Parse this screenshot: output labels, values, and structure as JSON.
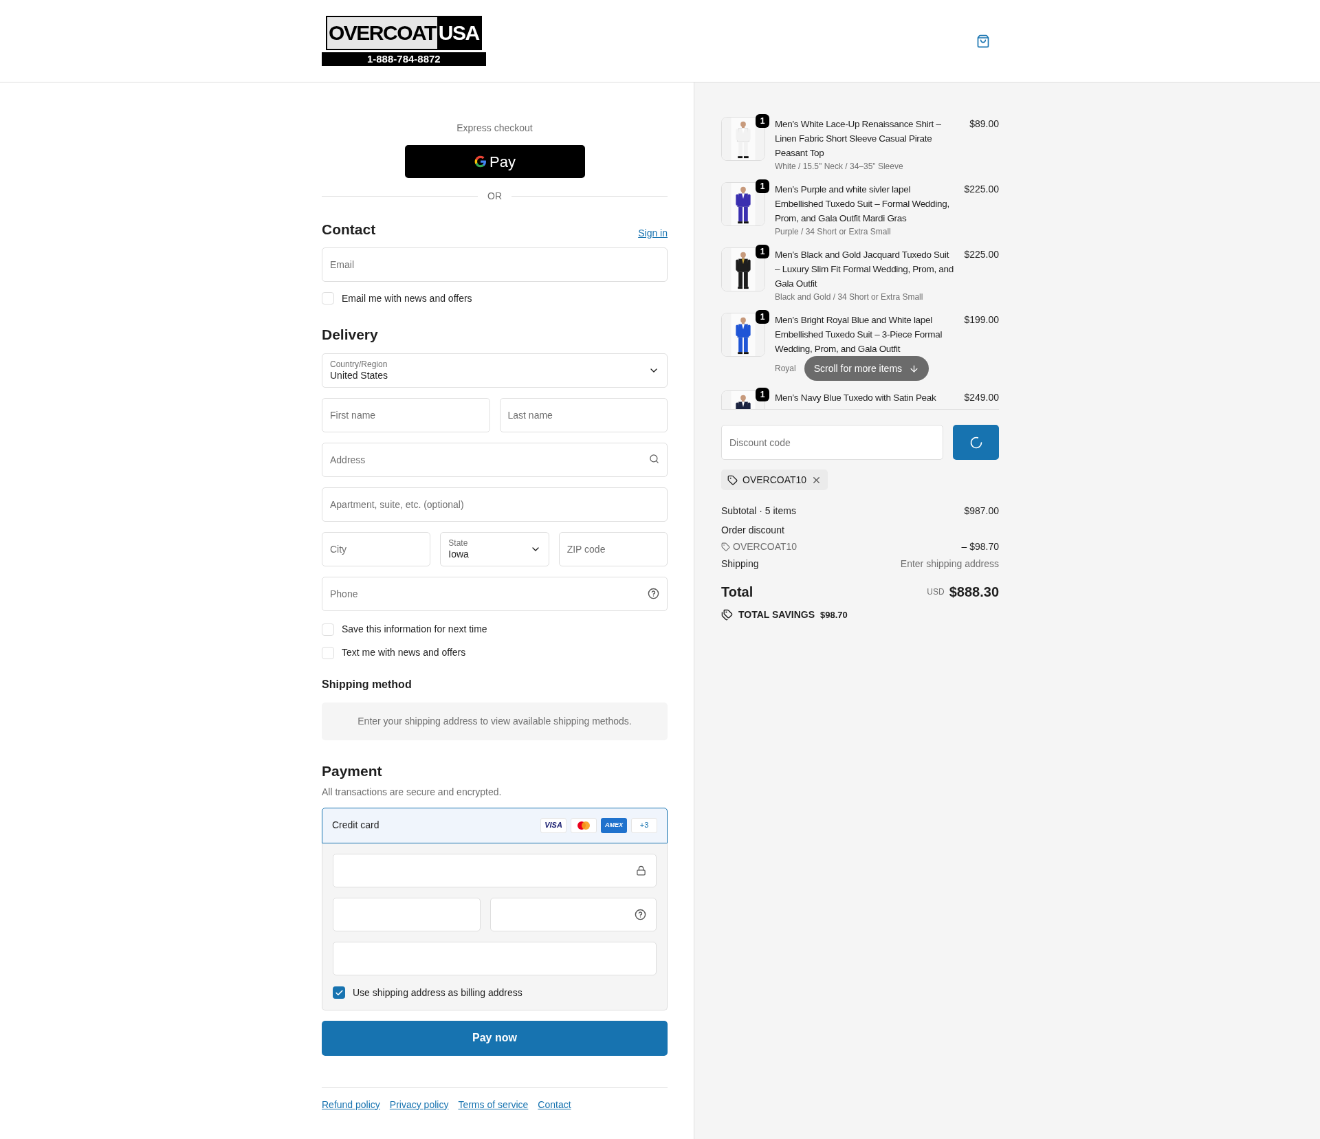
{
  "header": {
    "logo": {
      "word_left": "OVERCOAT",
      "word_right": "USA",
      "phone": "1-888-784-8872"
    }
  },
  "express": {
    "label": "Express checkout",
    "gpay": "Pay",
    "divider": "OR"
  },
  "contact": {
    "heading": "Contact",
    "sign_in": "Sign in",
    "email": {
      "placeholder": "Email"
    },
    "news": {
      "label": "Email me with news and offers",
      "checked": false
    }
  },
  "delivery": {
    "heading": "Delivery",
    "country": {
      "label": "Country/Region",
      "value": "United States"
    },
    "first_name": {
      "placeholder": "First name"
    },
    "last_name": {
      "placeholder": "Last name"
    },
    "address": {
      "placeholder": "Address"
    },
    "apartment": {
      "placeholder": "Apartment, suite, etc. (optional)"
    },
    "city": {
      "placeholder": "City"
    },
    "state": {
      "label": "State",
      "value": "Iowa"
    },
    "zip": {
      "placeholder": "ZIP code"
    },
    "phone": {
      "placeholder": "Phone"
    },
    "options": [
      {
        "label": "Save this information for next time",
        "checked": false
      },
      {
        "label": "Text me with news and offers",
        "checked": false
      }
    ]
  },
  "shipping_method": {
    "heading": "Shipping method",
    "message": "Enter your shipping address to view available shipping methods."
  },
  "payment": {
    "heading": "Payment",
    "subtitle": "All transactions are secure and encrypted.",
    "method": {
      "label": "Credit card",
      "selected": true,
      "brands": [
        {
          "kind": "visa",
          "text": "VISA"
        },
        {
          "kind": "mastercard"
        },
        {
          "kind": "amex",
          "text": "AMEX"
        },
        {
          "kind": "more",
          "text": "+3"
        }
      ]
    },
    "billing": {
      "label": "Use shipping address as billing address",
      "checked": true
    }
  },
  "pay_button": "Pay now",
  "footer_links": [
    "Refund policy",
    "Privacy policy",
    "Terms of service",
    "Contact"
  ],
  "summary": {
    "items": [
      {
        "quantity": "1",
        "title": "Men’s White Lace-Up Renaissance Shirt – Linen Fabric Short Sleeve Casual Pirate Peasant Top",
        "variant": "White / 15.5\" Neck / 34–35\" Sleeve",
        "price": "$89.00"
      },
      {
        "quantity": "1",
        "title": "Men’s Purple and white sivler lapel Embellished Tuxedo Suit – Formal Wedding, Prom, and Gala Outfit Mardi Gras",
        "variant": "Purple / 34 Short or Extra Small",
        "price": "$225.00"
      },
      {
        "quantity": "1",
        "title": "Men’s Black and Gold Jacquard Tuxedo Suit – Luxury Slim Fit Formal Wedding, Prom, and Gala Outfit",
        "variant": "Black and Gold / 34 Short or Extra Small",
        "price": "$225.00"
      },
      {
        "quantity": "1",
        "title": "Men’s Bright Royal Blue and White lapel Embellished Tuxedo Suit – 3-Piece Formal Wedding, Prom, and Gala Outfit",
        "variant": "Royal",
        "price": "$199.00"
      },
      {
        "quantity": "1",
        "title": "Men’s Navy Blue Tuxedo with Satin Peak",
        "price": "$249.00"
      }
    ],
    "scroll_hint": "Scroll for more items",
    "discount": {
      "placeholder": "Discount code",
      "applied_code": "OVERCOAT10"
    },
    "subtotal": {
      "label": "Subtotal · 5 items",
      "value": "$987.00"
    },
    "order_discount": {
      "label": "Order discount",
      "code": "OVERCOAT10",
      "value": "– $98.70"
    },
    "shipping": {
      "label": "Shipping",
      "value": "Enter shipping address"
    },
    "total": {
      "label": "Total",
      "currency": "USD",
      "value": "$888.30"
    },
    "savings": {
      "label": "TOTAL SAVINGS",
      "value": "$98.70"
    }
  }
}
